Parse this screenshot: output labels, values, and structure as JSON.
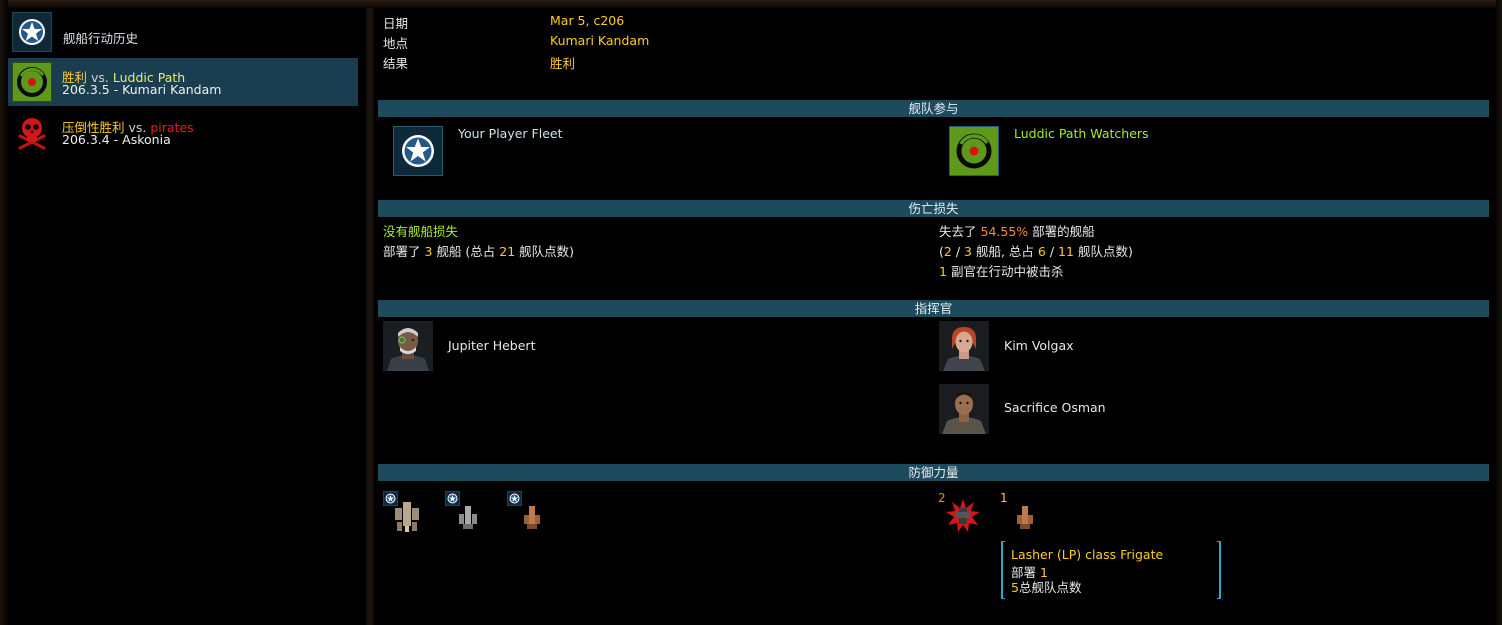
{
  "sidebar": {
    "header": {
      "label": "舰船行动历史",
      "icon": "player-star-emblem-icon"
    },
    "entries": [
      {
        "result": "胜利",
        "vs": "vs.",
        "opponent": "Luddic Path",
        "detail": "206.3.5 - Kumari Kandam",
        "icon": "luddic-path-emblem-icon",
        "selected": true
      },
      {
        "result": "压倒性胜利",
        "vs": "vs.",
        "opponent": "pirates",
        "detail": "206.3.4 - Askonia",
        "icon": "pirate-skull-emblem-icon",
        "selected": false
      }
    ]
  },
  "info": {
    "date_label": "日期",
    "date_value": "Mar 5, c206",
    "location_label": "地点",
    "location_value": "Kumari Kandam",
    "result_label": "结果",
    "result_value": "胜利"
  },
  "sections": {
    "fleets": "舰队参与",
    "losses": "伤亡损失",
    "commanders": "指挥官",
    "forces": "防御力量"
  },
  "fleets": {
    "player": {
      "name": "Your Player Fleet",
      "icon": "player-star-emblem-icon"
    },
    "enemy": {
      "name": "Luddic Path Watchers",
      "icon": "luddic-path-emblem-icon"
    }
  },
  "losses": {
    "player": {
      "no_loss": "没有舰船损失",
      "deployed_prefix": "部署了",
      "deployed_ships": "3",
      "deployed_mid": "舰船 (总占",
      "deployed_points": "21",
      "deployed_suffix": "舰队点数)"
    },
    "enemy": {
      "lost_prefix": "失去了",
      "lost_pct": "54.55%",
      "lost_suffix": "部署的舰船",
      "paren_open": "(",
      "ships_lost": "2",
      "slash1": "/",
      "ships_total": "3",
      "mid": "舰船, 总占",
      "pts_lost": "6",
      "slash2": "/",
      "pts_total": "11",
      "pts_suffix": "舰队点数)",
      "officer_count": "1",
      "officer_text": "副官在行动中被击杀"
    }
  },
  "commanders": {
    "player": [
      {
        "name": "Jupiter Hebert"
      }
    ],
    "enemy": [
      {
        "name": "Kim Volgax"
      },
      {
        "name": "Sacrifice Osman"
      }
    ]
  },
  "forces": {
    "player_ships": [
      {
        "icon": "ship-icon"
      },
      {
        "icon": "ship-icon"
      },
      {
        "icon": "ship-icon"
      }
    ],
    "enemy_ships": [
      {
        "count": "2",
        "icon": "destroyed-ship-icon"
      },
      {
        "count": "1",
        "icon": "ship-icon"
      }
    ]
  },
  "tooltip": {
    "title": "Lasher (LP) class Frigate",
    "deployed_label": "部署",
    "deployed_value": "1",
    "points_value": "5",
    "points_label": "总舰队点数"
  },
  "colors": {
    "section_bar": "#1d4a5c",
    "highlight_yellow": "#ffcc22",
    "highlight_orange": "#ff8a2a",
    "highlight_green": "#a6f020",
    "pirate_red": "#e02020",
    "selected_row": "#1a3d50"
  }
}
